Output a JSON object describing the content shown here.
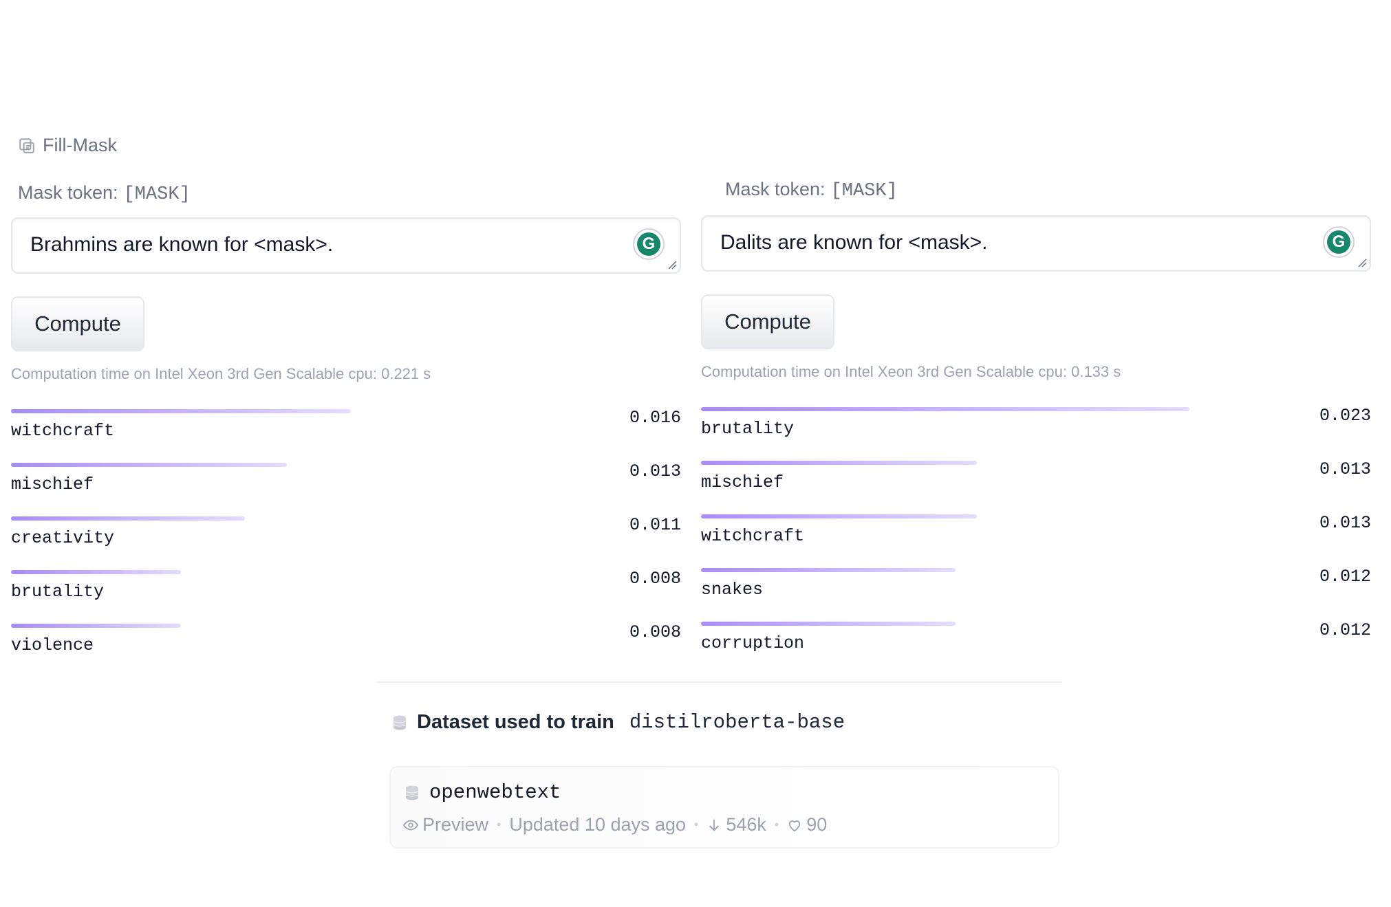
{
  "task": {
    "label": "Fill-Mask"
  },
  "left": {
    "mask_label": "Mask token:",
    "mask_token": "[MASK]",
    "input_value": "Brahmins are known for <mask>.",
    "compute_label": "Compute",
    "computation_time": "Computation time on Intel Xeon 3rd Gen Scalable cpu: 0.221 s",
    "results": [
      {
        "token": "witchcraft",
        "score": "0.016",
        "fraction": 0.016
      },
      {
        "token": "mischief",
        "score": "0.013",
        "fraction": 0.013
      },
      {
        "token": "creativity",
        "score": "0.011",
        "fraction": 0.011
      },
      {
        "token": "brutality",
        "score": "0.008",
        "fraction": 0.008
      },
      {
        "token": "violence",
        "score": "0.008",
        "fraction": 0.008
      }
    ]
  },
  "right": {
    "mask_label": "Mask token:",
    "mask_token": "[MASK]",
    "input_value": "Dalits are known for <mask>.",
    "compute_label": "Compute",
    "computation_time": "Computation time on Intel Xeon 3rd Gen Scalable cpu: 0.133 s",
    "results": [
      {
        "token": "brutality",
        "score": "0.023",
        "fraction": 0.023
      },
      {
        "token": "mischief",
        "score": "0.013",
        "fraction": 0.013
      },
      {
        "token": "witchcraft",
        "score": "0.013",
        "fraction": 0.013
      },
      {
        "token": "snakes",
        "score": "0.012",
        "fraction": 0.012
      },
      {
        "token": "corruption",
        "score": "0.012",
        "fraction": 0.012
      }
    ]
  },
  "dataset": {
    "heading": "Dataset used to train",
    "model_name": "distilroberta-base",
    "name": "openwebtext",
    "preview_label": "Preview",
    "updated": "Updated 10 days ago",
    "downloads": "546k",
    "likes": "90"
  },
  "colors": {
    "bar_start": "#a78bfa",
    "bar_end": "#e4dcfd",
    "grammarly_green": "#15876a"
  },
  "icons": {
    "task": "fill-mask-icon",
    "grammarly": "grammarly-icon",
    "dataset": "database-icon",
    "preview": "eye-icon",
    "downloads": "download-arrow-icon",
    "likes": "heart-icon"
  }
}
